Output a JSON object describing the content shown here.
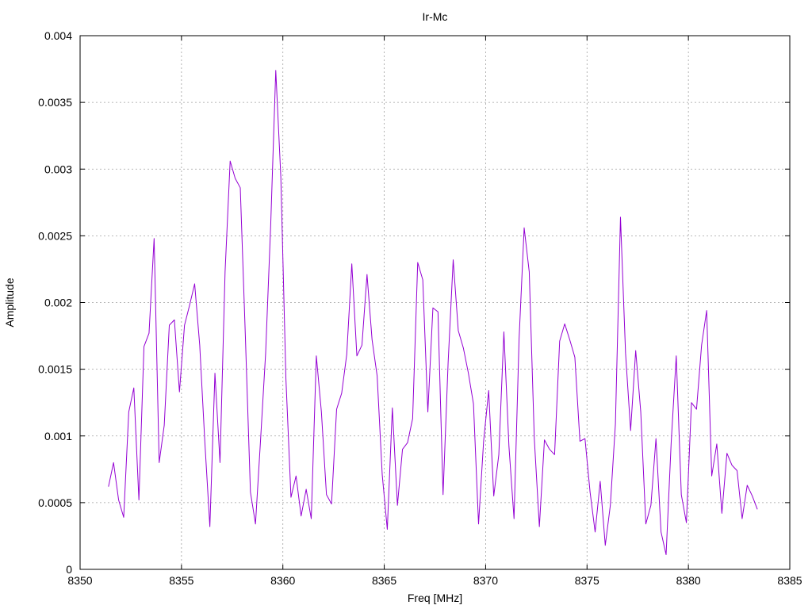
{
  "chart_data": {
    "type": "line",
    "title": "Ir-Mc",
    "xlabel": "Freq [MHz]",
    "ylabel": "Amplitude",
    "xlim": [
      8350,
      8385
    ],
    "ylim": [
      0,
      0.004
    ],
    "xticks": [
      8350,
      8355,
      8360,
      8365,
      8370,
      8375,
      8380,
      8385
    ],
    "yticks": [
      0,
      0.0005,
      0.001,
      0.0015,
      0.002,
      0.0025,
      0.003,
      0.0035,
      0.004
    ],
    "xtick_labels": [
      "8350",
      "8355",
      "8360",
      "8365",
      "8370",
      "8375",
      "8380",
      "8385"
    ],
    "ytick_labels": [
      "0",
      "0.0005",
      "0.001",
      "0.0015",
      "0.002",
      "0.0025",
      "0.003",
      "0.0035",
      "0.004"
    ],
    "grid": true,
    "line_color": "#9400d3",
    "series": [
      {
        "x": [
          8351.4,
          8351.65,
          8351.9,
          8352.15,
          8352.4,
          8352.65,
          8352.9,
          8353.15,
          8353.4,
          8353.65,
          8353.9,
          8354.15,
          8354.4,
          8354.65,
          8354.9,
          8355.15,
          8355.4,
          8355.65,
          8355.9,
          8356.15,
          8356.4,
          8356.65,
          8356.9,
          8357.15,
          8357.4,
          8357.65,
          8357.9,
          8358.15,
          8358.4,
          8358.65,
          8358.9,
          8359.15,
          8359.4,
          8359.65,
          8359.9,
          8360.15,
          8360.4,
          8360.65,
          8360.9,
          8361.15,
          8361.4,
          8361.65,
          8361.9,
          8362.15,
          8362.4,
          8362.65,
          8362.9,
          8363.15,
          8363.4,
          8363.65,
          8363.9,
          8364.15,
          8364.4,
          8364.65,
          8364.9,
          8365.15,
          8365.4,
          8365.65,
          8365.9,
          8366.15,
          8366.4,
          8366.65,
          8366.9,
          8367.15,
          8367.4,
          8367.65,
          8367.9,
          8368.15,
          8368.4,
          8368.65,
          8368.9,
          8369.15,
          8369.4,
          8369.65,
          8369.9,
          8370.15,
          8370.4,
          8370.65,
          8370.9,
          8371.15,
          8371.4,
          8371.65,
          8371.9,
          8372.15,
          8372.4,
          8372.65,
          8372.9,
          8373.15,
          8373.4,
          8373.65,
          8373.9,
          8374.15,
          8374.4,
          8374.65,
          8374.9,
          8375.15,
          8375.4,
          8375.65,
          8375.9,
          8376.15,
          8376.4,
          8376.65,
          8376.9,
          8377.15,
          8377.4,
          8377.65,
          8377.9,
          8378.15,
          8378.4,
          8378.65,
          8378.9,
          8379.15,
          8379.4,
          8379.65,
          8379.9,
          8380.15,
          8380.4,
          8380.65,
          8380.9,
          8381.15,
          8381.4,
          8381.65,
          8381.9,
          8382.15,
          8382.4,
          8382.65,
          8382.9,
          8383.15,
          8383.4
        ],
        "values": [
          0.00062,
          0.0008,
          0.00052,
          0.00039,
          0.00118,
          0.00136,
          0.00052,
          0.00167,
          0.00177,
          0.00248,
          0.0008,
          0.00108,
          0.00183,
          0.00187,
          0.00133,
          0.00183,
          0.00198,
          0.00214,
          0.00168,
          0.00096,
          0.00032,
          0.00147,
          0.0008,
          0.00223,
          0.00306,
          0.00293,
          0.00286,
          0.00175,
          0.00058,
          0.00034,
          0.00097,
          0.00162,
          0.00258,
          0.00374,
          0.00294,
          0.00143,
          0.00054,
          0.0007,
          0.0004,
          0.0006,
          0.00038,
          0.0016,
          0.00118,
          0.00056,
          0.00049,
          0.0012,
          0.00132,
          0.00161,
          0.00229,
          0.0016,
          0.00168,
          0.00221,
          0.00172,
          0.00145,
          0.00071,
          0.0003,
          0.00121,
          0.00048,
          0.0009,
          0.00095,
          0.00113,
          0.0023,
          0.00217,
          0.00118,
          0.00196,
          0.00193,
          0.00056,
          0.00155,
          0.00232,
          0.00179,
          0.00166,
          0.00147,
          0.00124,
          0.00034,
          0.00096,
          0.00134,
          0.00055,
          0.00086,
          0.00178,
          0.00092,
          0.00038,
          0.00173,
          0.00256,
          0.00223,
          0.00098,
          0.00032,
          0.00097,
          0.0009,
          0.00086,
          0.00171,
          0.00184,
          0.00172,
          0.00159,
          0.00096,
          0.00098,
          0.00058,
          0.00028,
          0.00066,
          0.00018,
          0.00048,
          0.00109,
          0.00264,
          0.00162,
          0.00104,
          0.00164,
          0.00118,
          0.00034,
          0.00048,
          0.00098,
          0.00028,
          0.00011,
          0.00095,
          0.0016,
          0.00056,
          0.00035,
          0.00125,
          0.0012,
          0.00168,
          0.00194,
          0.0007,
          0.00094,
          0.00042,
          0.00087,
          0.00078,
          0.00074,
          0.00038,
          0.00063,
          0.00055,
          0.00045
        ]
      }
    ]
  }
}
